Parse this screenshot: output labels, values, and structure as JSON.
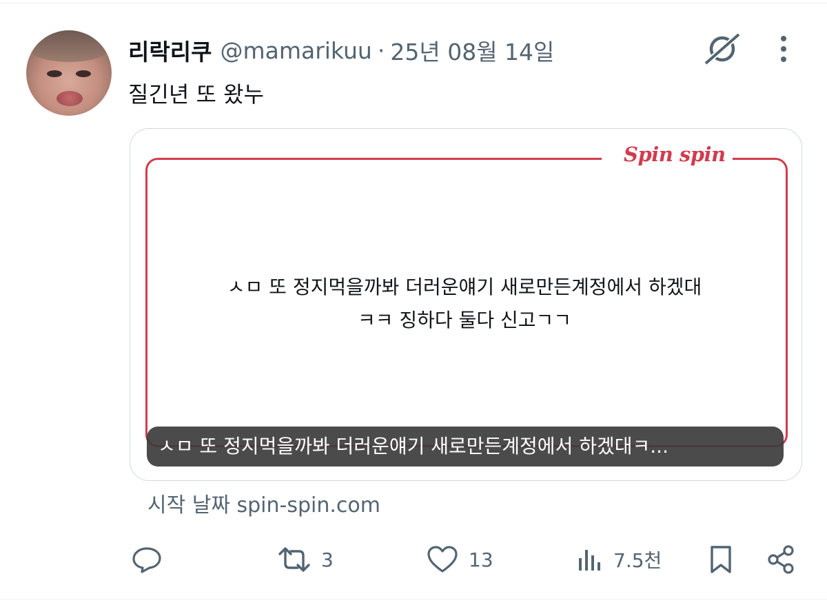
{
  "tweet": {
    "display_name": "리락리쿠",
    "handle": "@mamarikuu",
    "separator": "·",
    "date": "25년 08월 14일",
    "text": "질긴년 또 왔누"
  },
  "card": {
    "brand": "Spin spin",
    "line1": "ㅅㅁ 또 정지먹을까봐 더러운얘기 새로만든계정에서 하겠대",
    "line2": "ㅋㅋ 징하다 둘다 신고ㄱㄱ",
    "caption": "ㅅㅁ 또 정지먹을까봐 더러운얘기 새로만든계정에서 하겠대ㅋ...",
    "source": "시작 날짜 spin-spin.com"
  },
  "actions": {
    "retweets": "3",
    "likes": "13",
    "views": "7.5천"
  },
  "colors": {
    "brand_red": "#d13b4e",
    "secondary_text": "#536471",
    "primary_text": "#0f1419"
  }
}
